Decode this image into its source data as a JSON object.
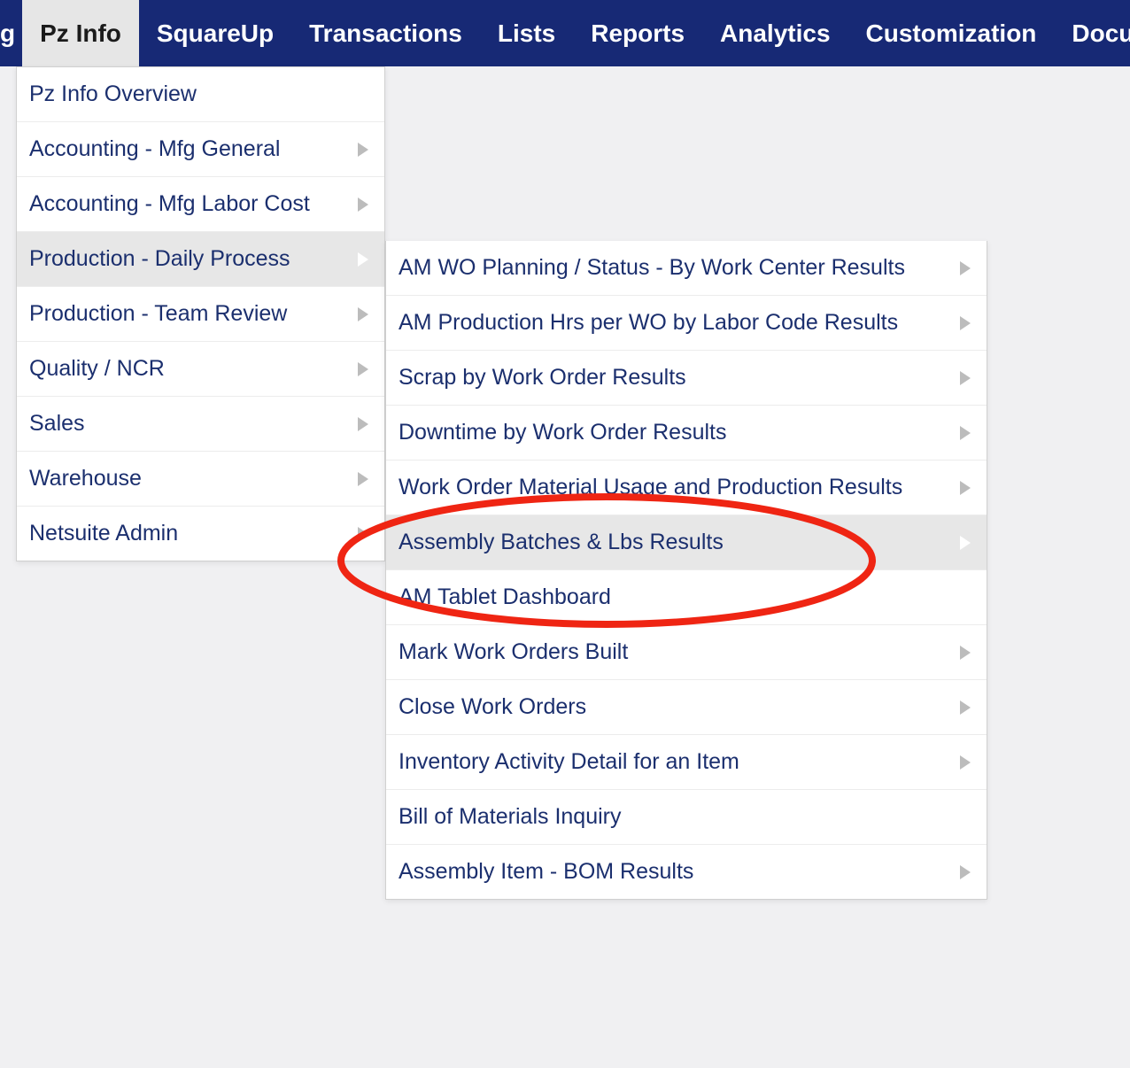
{
  "navbar": {
    "left_edge": "g",
    "items": [
      {
        "label": "Pz Info",
        "active": true
      },
      {
        "label": "SquareUp",
        "active": false
      },
      {
        "label": "Transactions",
        "active": false
      },
      {
        "label": "Lists",
        "active": false
      },
      {
        "label": "Reports",
        "active": false
      },
      {
        "label": "Analytics",
        "active": false
      },
      {
        "label": "Customization",
        "active": false
      },
      {
        "label": "Docume",
        "active": false
      }
    ]
  },
  "menu_level1": [
    {
      "label": "Pz Info Overview",
      "has_sub": false,
      "highlight": false
    },
    {
      "label": "Accounting - Mfg General",
      "has_sub": true,
      "highlight": false
    },
    {
      "label": "Accounting - Mfg Labor Cost",
      "has_sub": true,
      "highlight": false
    },
    {
      "label": "Production - Daily Process",
      "has_sub": true,
      "highlight": true
    },
    {
      "label": "Production - Team Review",
      "has_sub": true,
      "highlight": false
    },
    {
      "label": "Quality / NCR",
      "has_sub": true,
      "highlight": false
    },
    {
      "label": "Sales",
      "has_sub": true,
      "highlight": false
    },
    {
      "label": "Warehouse",
      "has_sub": true,
      "highlight": false
    },
    {
      "label": "Netsuite Admin",
      "has_sub": true,
      "highlight": false
    }
  ],
  "menu_level2": [
    {
      "label": "AM WO Planning / Status - By Work Center Results",
      "has_sub": true,
      "highlight": false
    },
    {
      "label": "AM Production Hrs per WO by Labor Code Results",
      "has_sub": true,
      "highlight": false
    },
    {
      "label": "Scrap by Work Order Results",
      "has_sub": true,
      "highlight": false
    },
    {
      "label": "Downtime by Work Order Results",
      "has_sub": true,
      "highlight": false
    },
    {
      "label": "Work Order Material Usage and Production Results",
      "has_sub": true,
      "highlight": false
    },
    {
      "label": "Assembly Batches & Lbs Results",
      "has_sub": true,
      "highlight": true
    },
    {
      "label": "AM Tablet Dashboard",
      "has_sub": false,
      "highlight": false
    },
    {
      "label": "Mark Work Orders Built",
      "has_sub": true,
      "highlight": false
    },
    {
      "label": "Close Work Orders",
      "has_sub": true,
      "highlight": false
    },
    {
      "label": "Inventory Activity Detail for an Item",
      "has_sub": true,
      "highlight": false
    },
    {
      "label": "Bill of Materials Inquiry",
      "has_sub": false,
      "highlight": false
    },
    {
      "label": "Assembly Item - BOM Results",
      "has_sub": true,
      "highlight": false
    }
  ],
  "annotation": {
    "circled_item_index": 5
  }
}
